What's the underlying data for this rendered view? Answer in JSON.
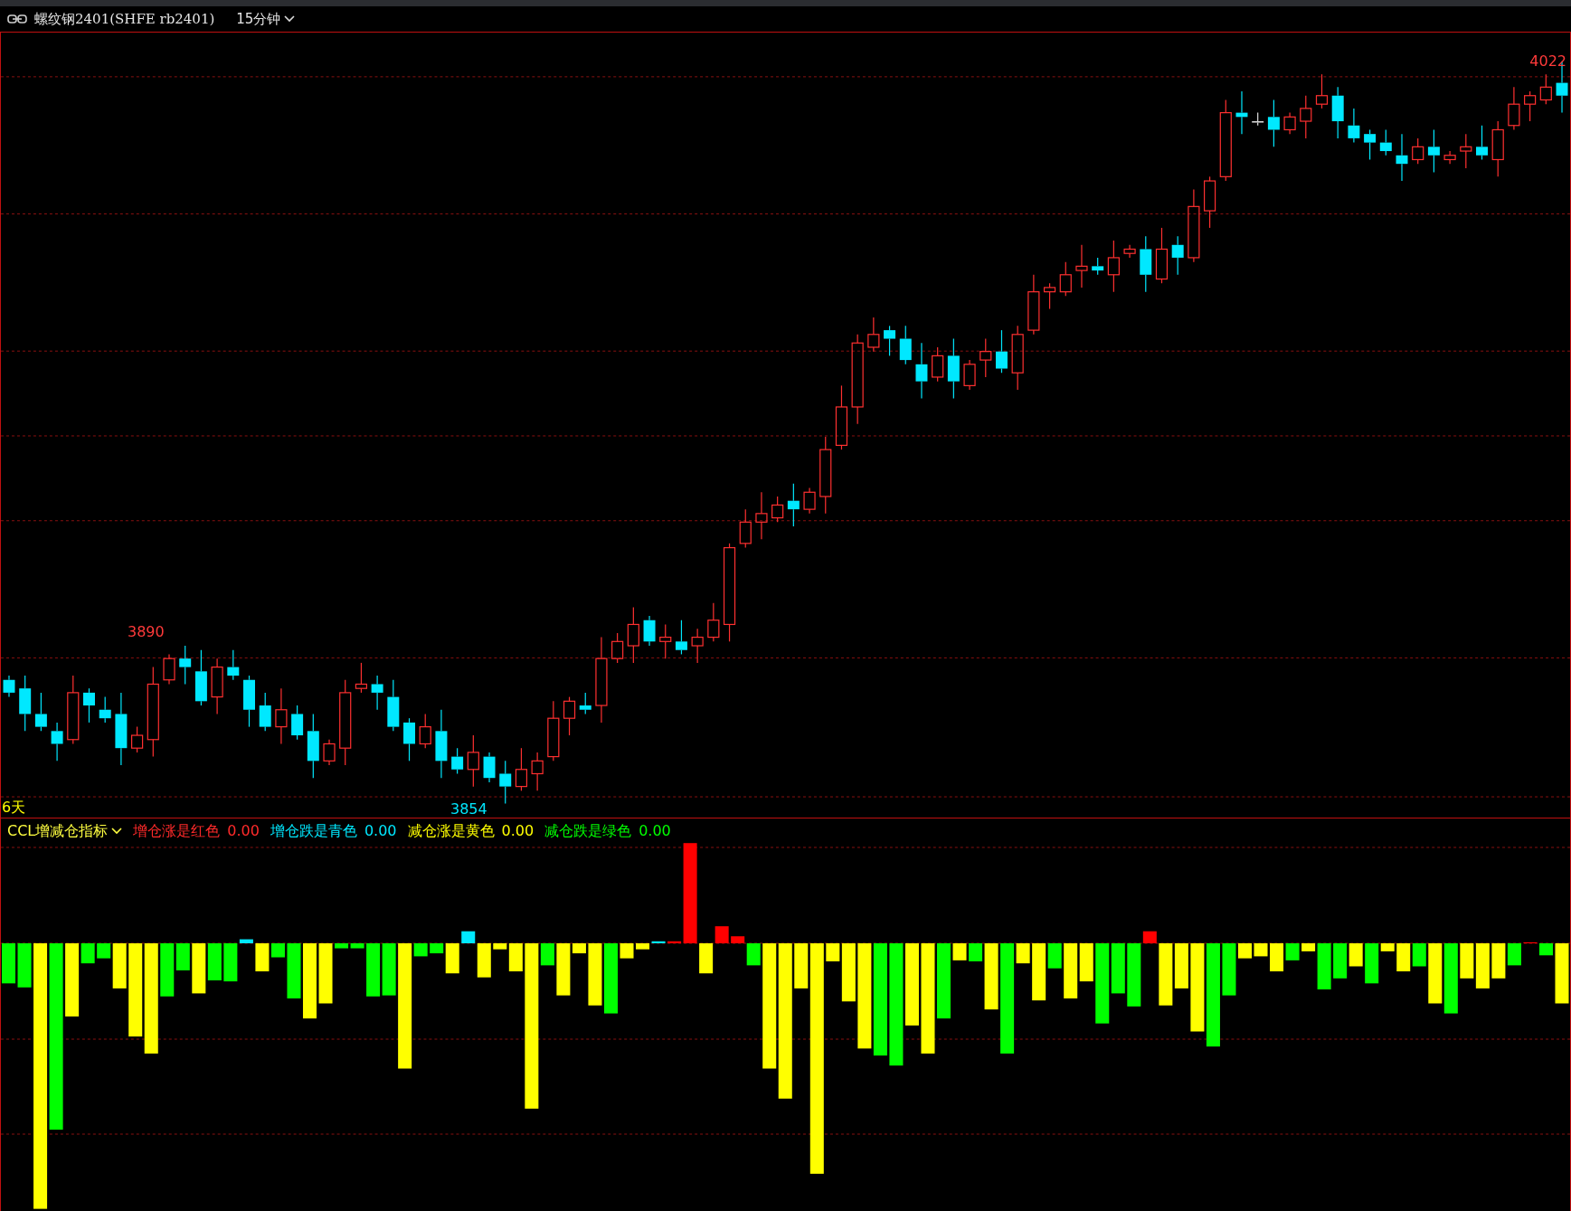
{
  "header": {
    "title": "螺纹钢2401(SHFE rb2401)",
    "period": "15分钟"
  },
  "price_chart": {
    "high_label": "4022",
    "prev_high_label": "3890",
    "low_label": "3854",
    "range_label": "6天"
  },
  "indicator": {
    "name": "CCL增减仓指标",
    "legend": [
      {
        "label": "增仓涨是红色",
        "value": "0.00",
        "color": "#ff2a2a"
      },
      {
        "label": "增仓跌是青色",
        "value": "0.00",
        "color": "#00e8ff"
      },
      {
        "label": "减仓涨是黄色",
        "value": "0.00",
        "color": "#ffff00"
      },
      {
        "label": "减仓跌是绿色",
        "value": "0.00",
        "color": "#00ff00"
      }
    ]
  }
}
